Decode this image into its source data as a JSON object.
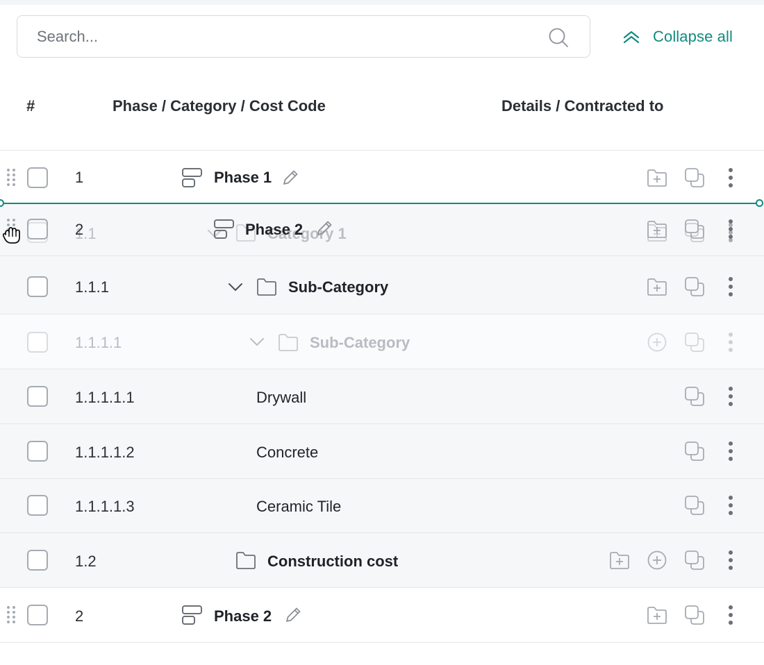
{
  "search": {
    "placeholder": "Search..."
  },
  "toolbar": {
    "collapse_label": "Collapse all"
  },
  "columns": {
    "number": "#",
    "name": "Phase / Category / Cost Code",
    "details": "Details / Contracted to"
  },
  "rows": [
    {
      "num": "1",
      "label": "Phase 1"
    },
    {
      "num": "1.1.1",
      "label": "Sub-Category"
    },
    {
      "num": "1.1.1.1",
      "label": "Sub-Category"
    },
    {
      "num": "1.1.1.1.1",
      "label": "Drywall"
    },
    {
      "num": "1.1.1.1.2",
      "label": "Concrete"
    },
    {
      "num": "1.1.1.1.3",
      "label": "Ceramic Tile"
    },
    {
      "num": "1.2",
      "label": "Construction cost"
    },
    {
      "num": "2",
      "label": "Phase 2"
    }
  ],
  "ghost_row": {
    "num": "1.1",
    "label": "Category 1"
  },
  "dragged_row": {
    "num": "2",
    "label": "Phase 2"
  },
  "colors": {
    "accent": "#128a7f",
    "icon": "#a6abb2"
  }
}
